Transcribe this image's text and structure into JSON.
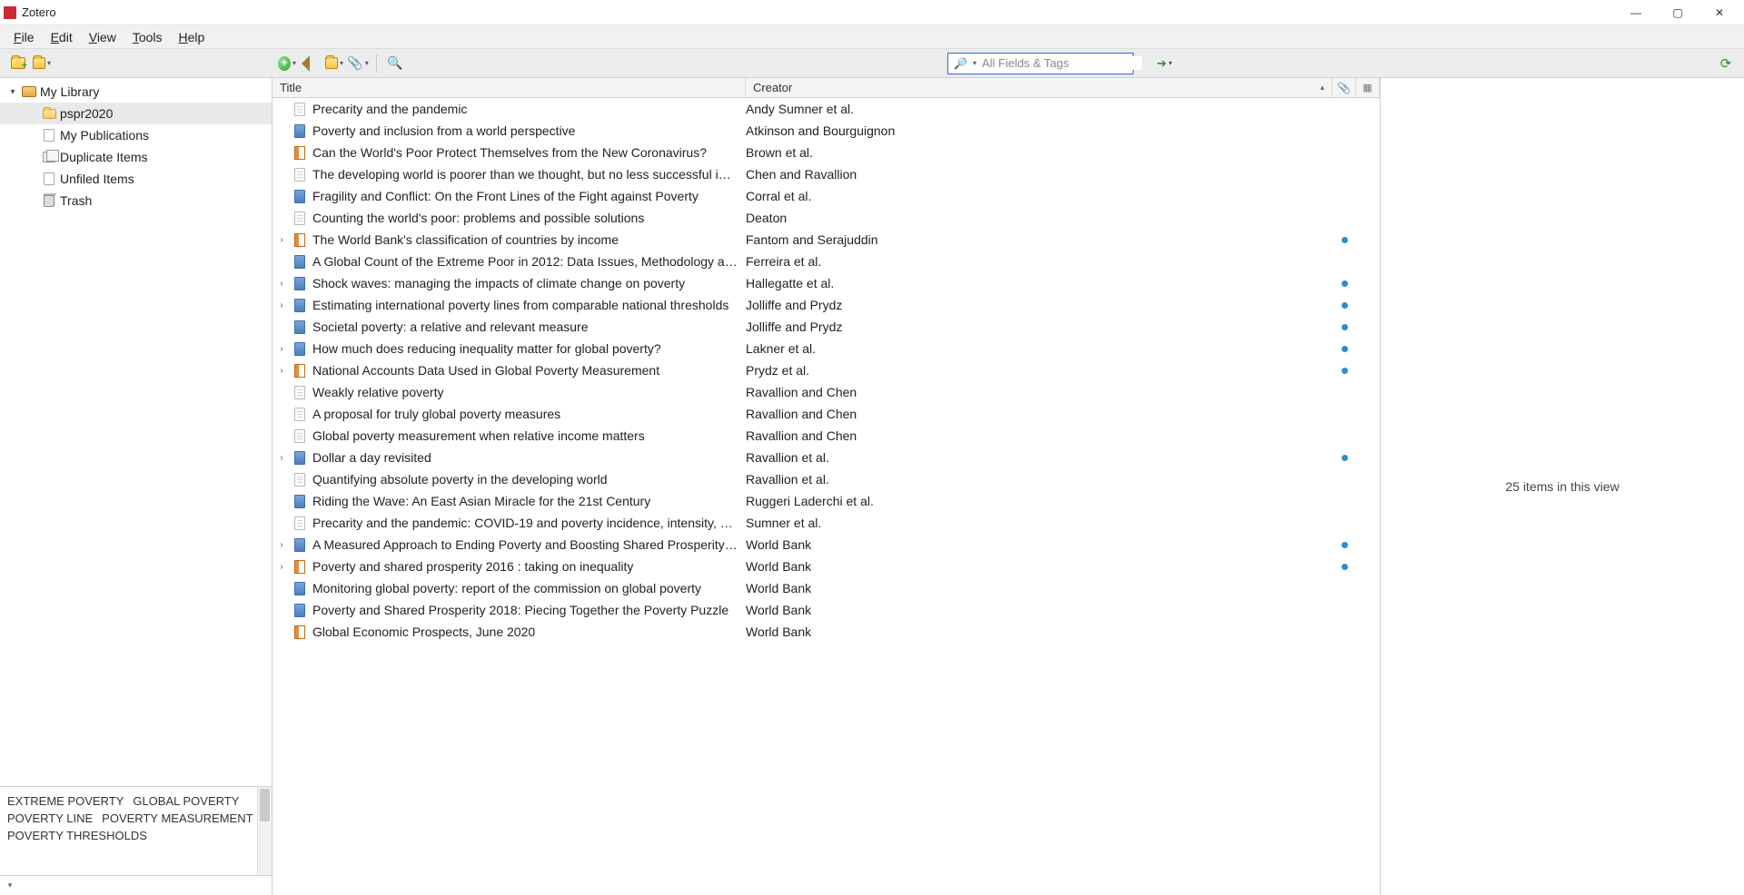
{
  "app_title": "Zotero",
  "menu": {
    "file": "File",
    "edit": "Edit",
    "view": "View",
    "tools": "Tools",
    "help": "Help"
  },
  "search": {
    "placeholder": "All Fields & Tags"
  },
  "library": {
    "root": "My Library",
    "nodes": [
      {
        "label": "pspr2020",
        "icon": "folder",
        "indent": 1,
        "selected": true
      },
      {
        "label": "My Publications",
        "icon": "doc",
        "indent": 1
      },
      {
        "label": "Duplicate Items",
        "icon": "dup",
        "indent": 1
      },
      {
        "label": "Unfiled Items",
        "icon": "doc",
        "indent": 1
      },
      {
        "label": "Trash",
        "icon": "trash",
        "indent": 1
      }
    ]
  },
  "tags": [
    "EXTREME POVERTY",
    "GLOBAL POVERTY",
    "POVERTY LINE",
    "POVERTY MEASUREMENT",
    "POVERTY THRESHOLDS"
  ],
  "columns": {
    "title": "Title",
    "creator": "Creator"
  },
  "items": [
    {
      "type": "doc",
      "title": "Precarity and the pandemic",
      "creator": "Andy Sumner et al.",
      "exp": false,
      "att": false
    },
    {
      "type": "book",
      "title": "Poverty and inclusion from a world perspective",
      "creator": "Atkinson and Bourguignon",
      "exp": false,
      "att": false
    },
    {
      "type": "booksec",
      "title": "Can the World's Poor Protect Themselves from the New Coronavirus?",
      "creator": "Brown et al.",
      "exp": false,
      "att": false
    },
    {
      "type": "doc",
      "title": "The developing world is poorer than we thought, but no less successful i…",
      "creator": "Chen and Ravallion",
      "exp": false,
      "att": false
    },
    {
      "type": "book",
      "title": "Fragility and Conflict: On the Front Lines of the Fight against Poverty",
      "creator": "Corral et al.",
      "exp": false,
      "att": false
    },
    {
      "type": "doc",
      "title": "Counting the world's poor: problems and possible solutions",
      "creator": "Deaton",
      "exp": false,
      "att": false
    },
    {
      "type": "booksec",
      "title": "The World Bank's classification of countries by income",
      "creator": "Fantom and Serajuddin",
      "exp": true,
      "att": true
    },
    {
      "type": "book",
      "title": "A Global Count of the Extreme Poor in 2012: Data Issues, Methodology a…",
      "creator": "Ferreira et al.",
      "exp": false,
      "att": false
    },
    {
      "type": "book",
      "title": "Shock waves: managing the impacts of climate change on poverty",
      "creator": "Hallegatte et al.",
      "exp": true,
      "att": true
    },
    {
      "type": "book",
      "title": "Estimating international poverty lines from comparable national thresholds",
      "creator": "Jolliffe and Prydz",
      "exp": true,
      "att": true
    },
    {
      "type": "book",
      "title": "Societal poverty: a relative and relevant measure",
      "creator": "Jolliffe and Prydz",
      "exp": false,
      "att": true
    },
    {
      "type": "book",
      "title": "How much does reducing inequality matter for global poverty?",
      "creator": "Lakner et al.",
      "exp": true,
      "att": true
    },
    {
      "type": "booksec",
      "title": "National Accounts Data Used in Global Poverty Measurement",
      "creator": "Prydz et al.",
      "exp": true,
      "att": true
    },
    {
      "type": "doc",
      "title": "Weakly relative poverty",
      "creator": "Ravallion and Chen",
      "exp": false,
      "att": false
    },
    {
      "type": "doc",
      "title": "A proposal for truly global poverty measures",
      "creator": "Ravallion and Chen",
      "exp": false,
      "att": false
    },
    {
      "type": "doc",
      "title": "Global poverty measurement when relative income matters",
      "creator": "Ravallion and Chen",
      "exp": false,
      "att": false
    },
    {
      "type": "book",
      "title": "Dollar a day revisited",
      "creator": "Ravallion et al.",
      "exp": true,
      "att": true
    },
    {
      "type": "doc",
      "title": "Quantifying absolute poverty in the developing world",
      "creator": "Ravallion et al.",
      "exp": false,
      "att": false
    },
    {
      "type": "book",
      "title": "Riding the Wave: An East Asian Miracle for the 21st Century",
      "creator": "Ruggeri Laderchi et al.",
      "exp": false,
      "att": false
    },
    {
      "type": "doc",
      "title": "Precarity and the pandemic: COVID-19 and poverty incidence, intensity, a…",
      "creator": "Sumner et al.",
      "exp": false,
      "att": false
    },
    {
      "type": "book",
      "title": "A Measured Approach to Ending Poverty and Boosting Shared Prosperity…",
      "creator": "World Bank",
      "exp": true,
      "att": true
    },
    {
      "type": "booksec",
      "title": "Poverty and shared prosperity 2016 : taking on inequality",
      "creator": "World Bank",
      "exp": true,
      "att": true
    },
    {
      "type": "book",
      "title": "Monitoring global poverty: report of the commission on global poverty",
      "creator": "World Bank",
      "exp": false,
      "att": false
    },
    {
      "type": "book",
      "title": "Poverty and Shared Prosperity 2018: Piecing Together the Poverty Puzzle",
      "creator": "World Bank",
      "exp": false,
      "att": false
    },
    {
      "type": "booksec",
      "title": "Global Economic Prospects, June 2020",
      "creator": "World Bank",
      "exp": false,
      "att": false
    }
  ],
  "details": {
    "summary": "25 items in this view"
  }
}
